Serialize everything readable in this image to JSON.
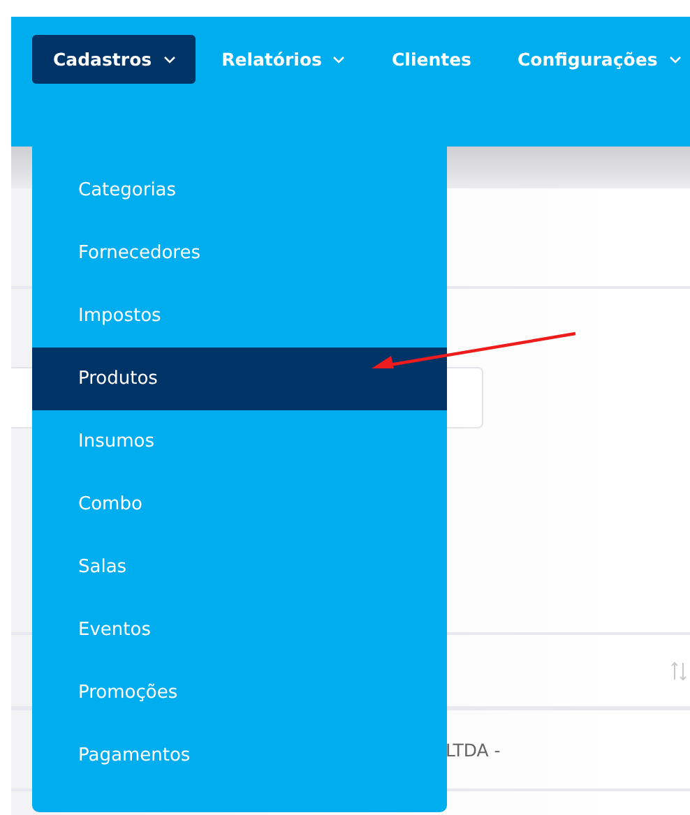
{
  "nav": [
    {
      "label": "Cadastros",
      "selected": true,
      "dropdown": true
    },
    {
      "label": "Relatórios",
      "selected": false,
      "dropdown": true
    },
    {
      "label": "Clientes",
      "selected": false,
      "dropdown": false
    },
    {
      "label": "Configurações",
      "selected": false,
      "dropdown": true
    }
  ],
  "menu": {
    "items": [
      {
        "label": "Categorias",
        "selected": false
      },
      {
        "label": "Fornecedores",
        "selected": false
      },
      {
        "label": "Impostos",
        "selected": false
      },
      {
        "label": "Produtos",
        "selected": true
      },
      {
        "label": "Insumos",
        "selected": false
      },
      {
        "label": "Combo",
        "selected": false
      },
      {
        "label": "Salas",
        "selected": false
      },
      {
        "label": "Eventos",
        "selected": false
      },
      {
        "label": "Promoções",
        "selected": false
      },
      {
        "label": "Pagamentos",
        "selected": false
      }
    ]
  },
  "table": {
    "rows": [
      {
        "cell": "LTDA -"
      }
    ]
  }
}
